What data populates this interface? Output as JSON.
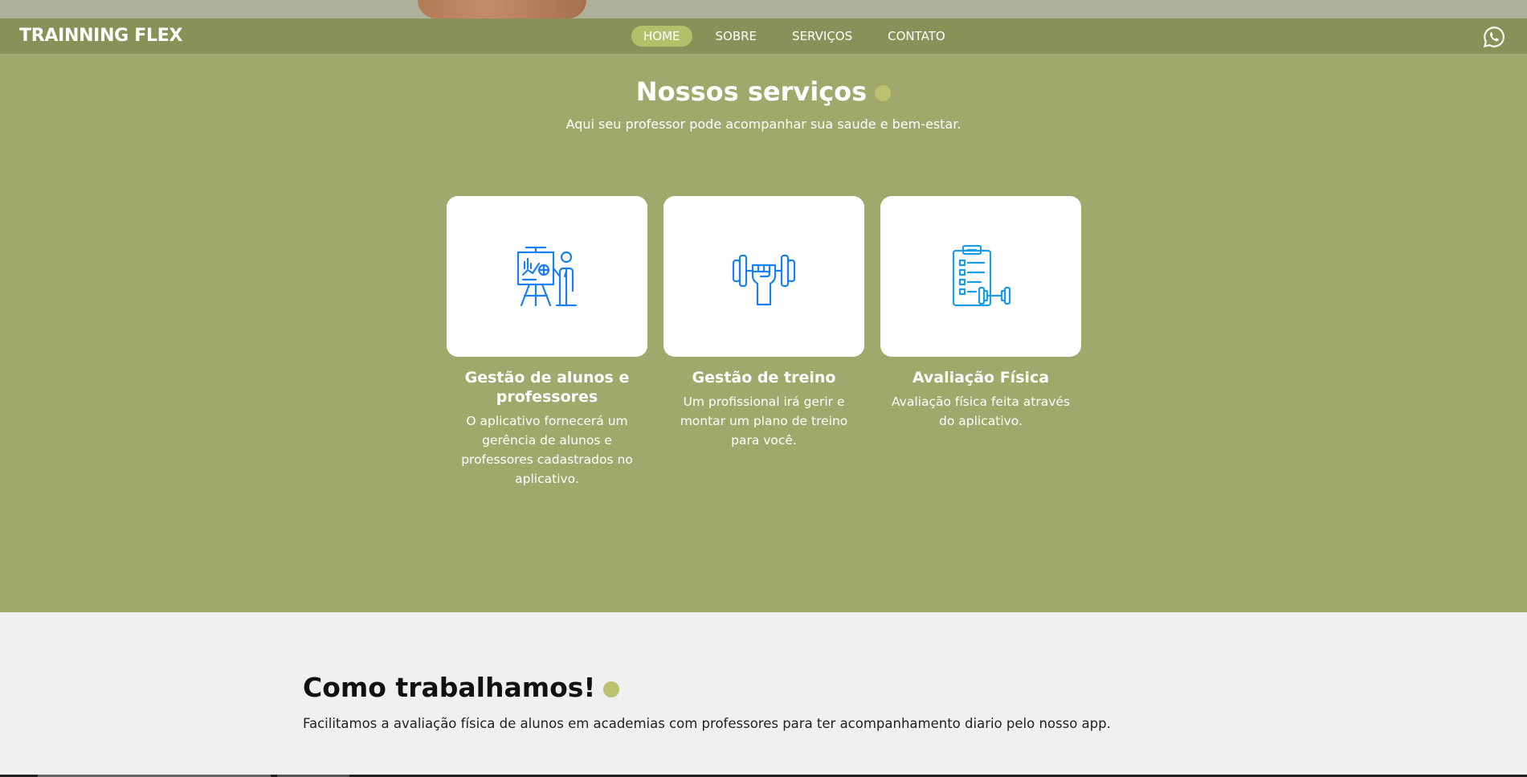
{
  "brand": {
    "name": "TRAINNING FLEX"
  },
  "nav": {
    "items": [
      {
        "label": "HOME",
        "active": true
      },
      {
        "label": "SOBRE"
      },
      {
        "label": "SERVIÇOS"
      },
      {
        "label": "CONTATO"
      }
    ],
    "contact_icon": "whatsapp-icon"
  },
  "services": {
    "title": "Nossos serviços",
    "subtitle": "Aqui seu professor pode acompanhar sua saude e bem-estar.",
    "cards": [
      {
        "icon": "presentation-icon",
        "title": "Gestão de alunos e professores",
        "desc": "O aplicativo fornecerá um gerência de alunos e professores cadastrados no aplicativo."
      },
      {
        "icon": "dumbbell-hand-icon",
        "title": "Gestão de treino",
        "desc": "Um profissional irá gerir e montar um plano de treino para você."
      },
      {
        "icon": "clipboard-dumbbell-icon",
        "title": "Avaliação Física",
        "desc": "Avaliação física feita através do aplicativo."
      }
    ]
  },
  "how": {
    "title": "Como trabalhamos!",
    "text": "Facilitamos a avaliação física de alunos em academias com professores para ter acompanhamento diario pelo nosso app."
  },
  "colors": {
    "navbar": "#8a9158",
    "services_bg": "#a0a86c",
    "accent_dot": "#b9c26e",
    "icon_blue": "#1a7ff0"
  }
}
